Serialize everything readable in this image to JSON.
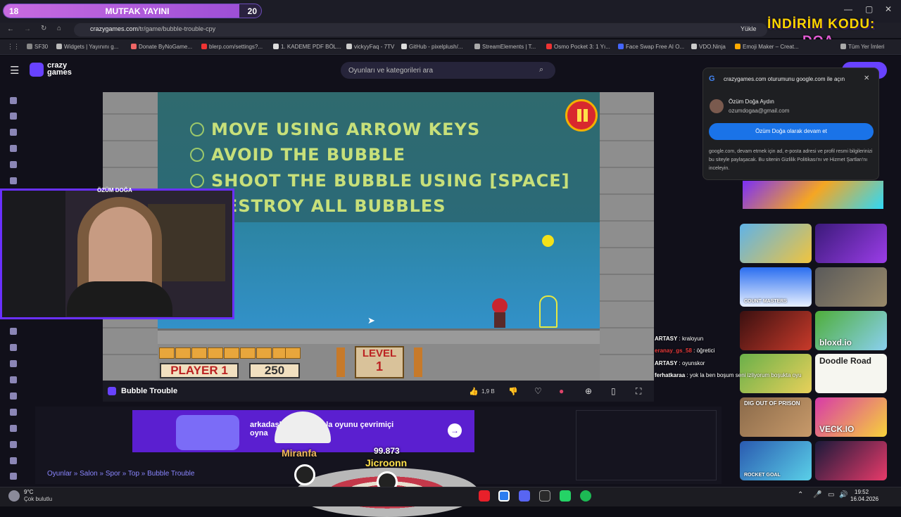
{
  "stream_bar": {
    "left_count": "18",
    "title": "MUTFAK YAYINI",
    "right_count": "20"
  },
  "promo": {
    "line1": "İNDİRİM KODU:",
    "line2": "DOA"
  },
  "browser": {
    "url_host": "crazygames.com",
    "url_path": "/tr/game/bubble-trouble-cpy",
    "install_label": "Yükle",
    "bookmarks": [
      "SF30",
      "Widgets | Yayınını g...",
      "Donate ByNoGame...",
      "blerp.com/settings?...",
      "1. KADEME PDF BÖL...",
      "vickyyFaq - 7TV",
      "GitHub - pixelplush/...",
      "StreamElements | T...",
      "Osmo Pocket 3: 1 Yı...",
      "Face Swap Free AI O...",
      "VDO.Ninja",
      "Emoji Maker – Creat...",
      "Tüm Yer İmleri"
    ]
  },
  "site": {
    "logo_line1": "crazy",
    "logo_line2": "games",
    "search_placeholder": "Oyunları ve kategorileri ara"
  },
  "game": {
    "instructions": [
      "MOVE USING ARROW KEYS",
      "AVOID THE BUBBLE",
      "SHOOT THE BUBBLE USING [SPACE]",
      "DESTROY ALL BUBBLES"
    ],
    "player_label": "PLAYER 1",
    "score": "250",
    "level_label": "LEVEL",
    "level_value": "1",
    "title": "Bubble Trouble",
    "likes": "1,9 B"
  },
  "webcam": {
    "label": "ÖZÜM DOĞA"
  },
  "google_prompt": {
    "title": "crazygames.com oturumunu google.com ile açın",
    "name": "Özüm Doğa Aydın",
    "email": "ozumdogaa@gmail.com",
    "button": "Özüm Doğa olarak devam et",
    "note": "google.com, devam etmek için ad, e-posta adresi ve profil resmi bilgilerinizi bu siteyle paylaşacak. Bu sitenin Gizlilik Politikası'nı ve Hizmet Şartları'nı inceleyin."
  },
  "chat": [
    {
      "user": "ARTASY",
      "msg": "kraloyun"
    },
    {
      "user": "eranay_gs_58",
      "msg": "öğretici"
    },
    {
      "user": "ARTASY",
      "msg": "oyunskor"
    },
    {
      "user": "ferhatkaraa",
      "msg": "yok la ben boşum seni izliyorum boşukta oyu"
    }
  ],
  "thumbs": [
    "COUNT MASTERS",
    "bloxd.io",
    "Doodle Road",
    "DIG OUT OF PRISON",
    "VECK.IO",
    "ROCKET GOAL"
  ],
  "ad": {
    "text1": "arkadaşlarınla en fazla oyunu çevrimiçi",
    "text2": "oyna"
  },
  "breadcrumb": "Oyunlar » Salon » Spor » Top » Bubble Trouble",
  "overlay": {
    "name1": "Miranfa",
    "name2": "Jicroonn",
    "count": "99.873"
  },
  "taskbar": {
    "temp": "9°C",
    "weather": "Çok bulutlu",
    "time": "19:52",
    "date": "16.04.2026"
  }
}
